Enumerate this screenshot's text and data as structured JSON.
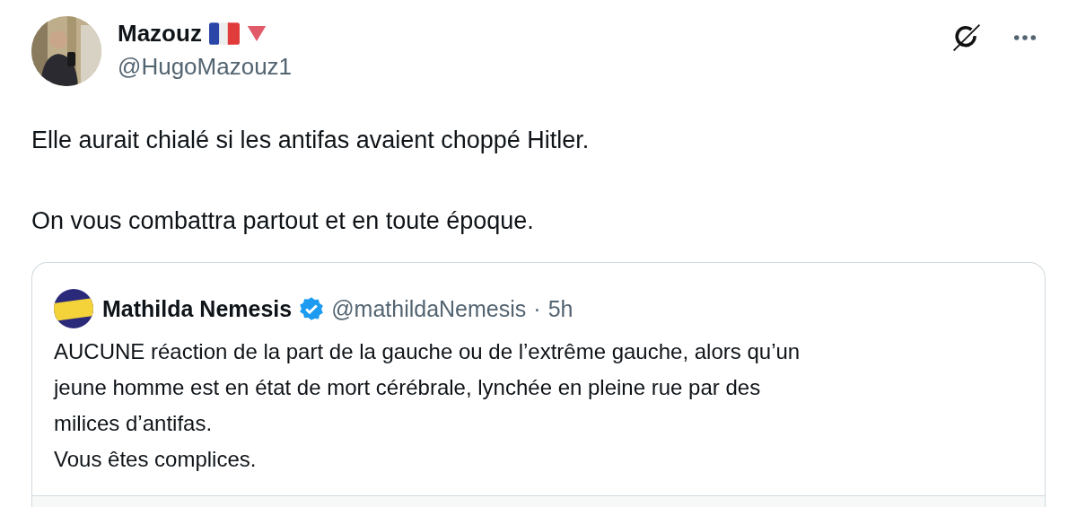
{
  "tweet": {
    "author": {
      "name": "Mazouz",
      "handle": "@HugoMazouz1"
    },
    "paragraphs": [
      "Elle aurait chialé si les antifas avaient choppé Hitler.",
      "On vous combattra partout et en toute époque."
    ],
    "quoted": {
      "name": "Mathilda Nemesis",
      "verified": true,
      "handle": "@mathildaNemesis",
      "separator": "·",
      "time": "5h",
      "lines": [
        "AUCUNE réaction de la part de la gauche ou de l’extrême gauche, alors qu’un",
        "jeune homme est en état de mort cérébrale, lynchée en pleine rue par des",
        "milices d’antifas.",
        "Vous êtes complices."
      ]
    }
  }
}
